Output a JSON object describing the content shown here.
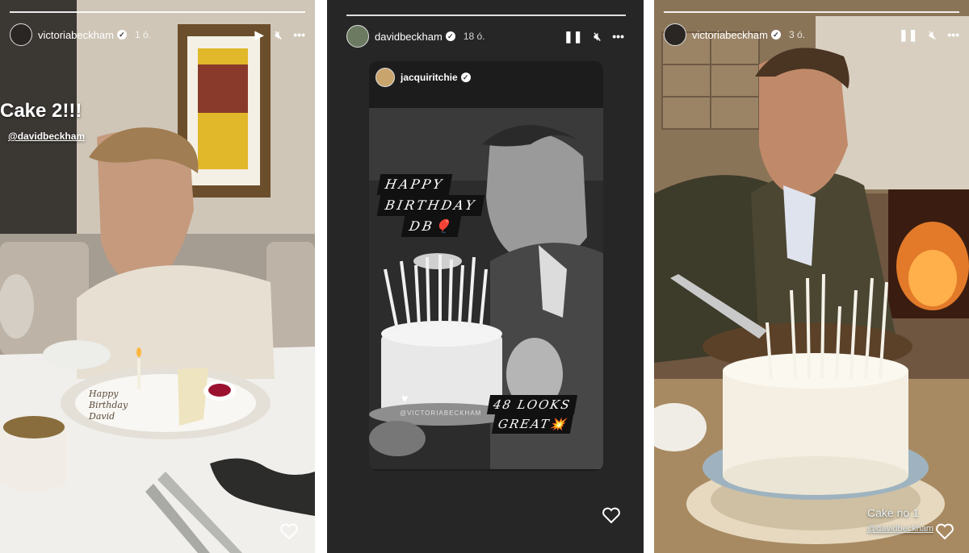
{
  "stories": [
    {
      "username": "victoriabeckham",
      "time": "1 ó.",
      "caption": "Cake 2!!!",
      "mention": "@davidbeckham",
      "plate_text": "Happy Birthday David",
      "icons": {
        "play": "play-icon",
        "mute": "mute-icon",
        "more": "more-icon",
        "like": "heart-icon"
      }
    },
    {
      "username": "davidbeckham",
      "time": "18 ó.",
      "reshared_username": "jacquiritchie",
      "sticker_lines": [
        "HAPPY",
        "BIRTHDAY",
        "DB🎈"
      ],
      "cake_mention": "@VICTORIABECKHAM",
      "looks_lines": [
        "48 LOOKS",
        "GREAT💥"
      ],
      "icons": {
        "pause": "pause-icon",
        "mute": "mute-icon",
        "more": "more-icon",
        "like": "heart-icon"
      }
    },
    {
      "username": "victoriabeckham",
      "time": "3 ó.",
      "caption": "Cake no 1",
      "mention": "@davidbeckham",
      "icons": {
        "pause": "pause-icon",
        "mute": "mute-icon",
        "more": "more-icon",
        "like": "heart-icon"
      }
    }
  ]
}
